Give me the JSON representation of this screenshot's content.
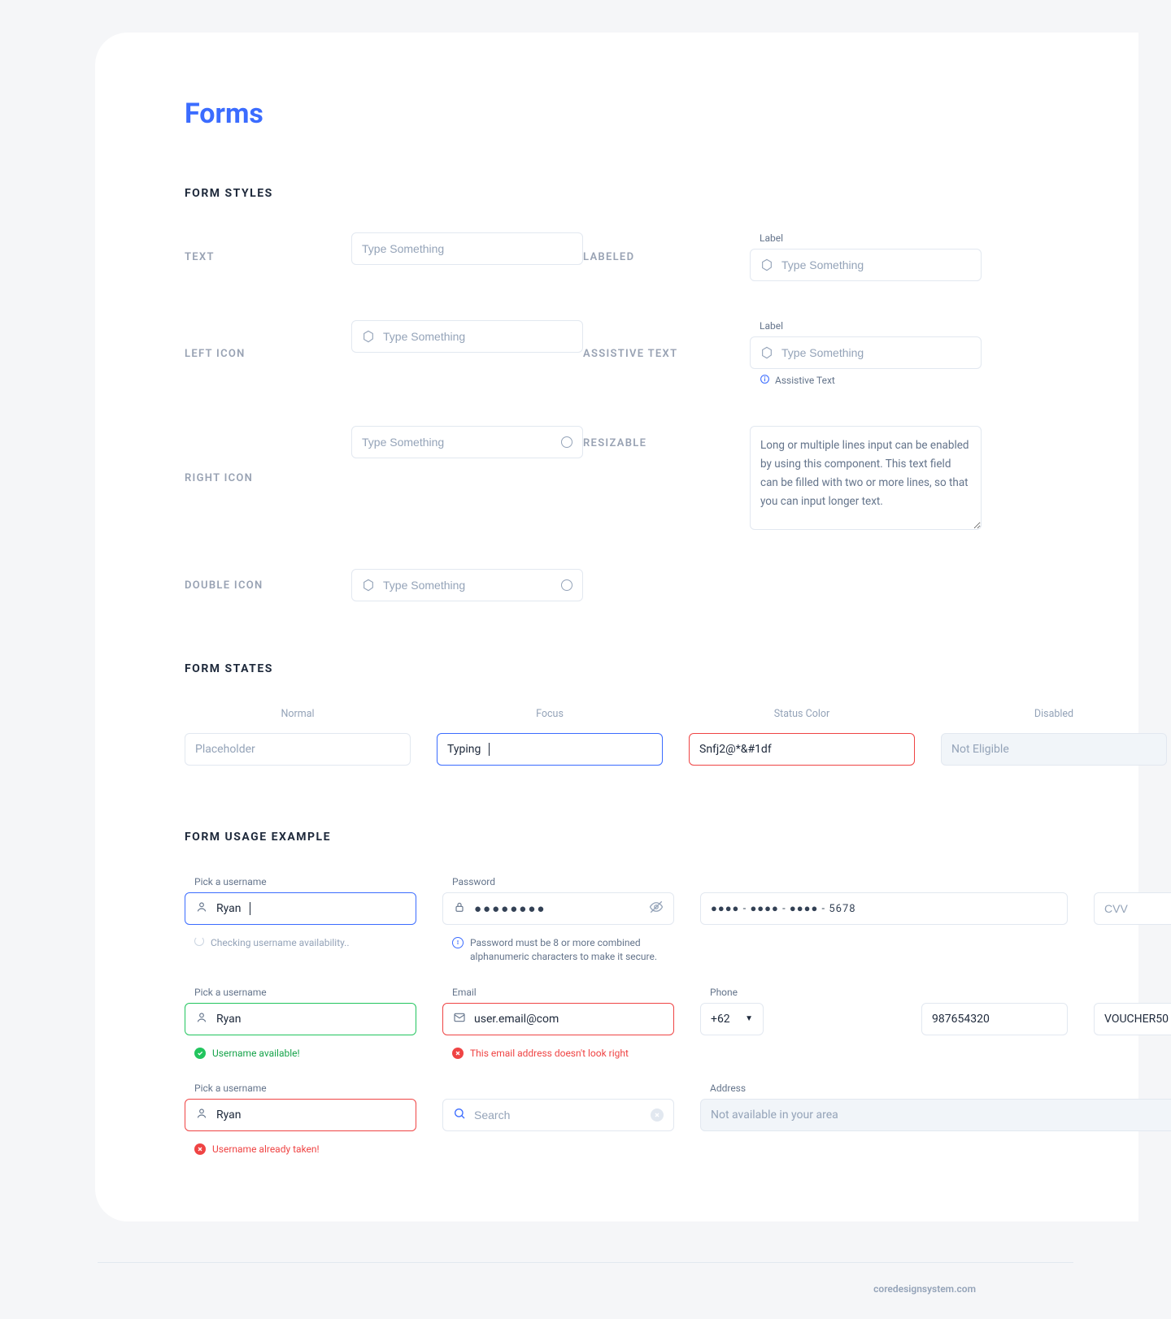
{
  "page": {
    "title": "Forms"
  },
  "sections": {
    "styles_title": "Form Styles",
    "states_title": "Form States",
    "usage_title": "Form Usage Example"
  },
  "styles": {
    "text_label": "Text",
    "left_icon_label": "Left Icon",
    "right_icon_label": "Right Icon",
    "double_icon_label": "Double Icon",
    "labeled_label": "Labeled",
    "assistive_label": "Assistive Text",
    "resizable_label": "Resizable",
    "placeholder": "Type Something",
    "field_label": "Label",
    "assistive_text": "Assistive Text",
    "textarea_value": "Long or multiple lines input can be enabled by using this component. This text field can be filled with two or more lines, so that you can input longer text."
  },
  "states": {
    "normal": {
      "name": "Normal",
      "placeholder": "Placeholder"
    },
    "focus": {
      "name": "Focus",
      "value": "Typing"
    },
    "status": {
      "name": "Status Color",
      "value": "Snfj2@*&#1df"
    },
    "disabled": {
      "name": "Disabled",
      "value": "Not Eligible"
    }
  },
  "usage": {
    "username_label": "Pick a username",
    "username_value": "Ryan",
    "checking_msg": "Checking username availability..",
    "available_msg": "Username available!",
    "taken_msg": "Username already taken!",
    "password_label": "Password",
    "password_hint": "Password must be 8 or more combined alphanumeric characters to make it secure.",
    "email_label": "Email",
    "email_value": "user.email@com",
    "email_error": "This email address doesn't look right",
    "search_placeholder": "Search",
    "card_masked": "●●●● - ●●●● - ●●●● - 5678",
    "cvv_placeholder": "CVV",
    "phone_label": "Phone",
    "phone_code": "+62",
    "phone_value": "987654320",
    "voucher_value": "VOUCHER50",
    "address_label": "Address",
    "address_value": "Not available in your area"
  },
  "footer": {
    "text": "coredesignsystem.com"
  }
}
